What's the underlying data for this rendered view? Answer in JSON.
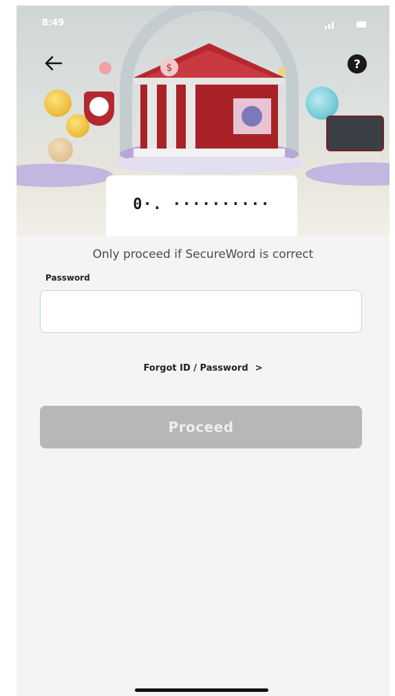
{
  "status_bar": {
    "time": "8:49"
  },
  "secure_word": {
    "value": "0·.  ··········"
  },
  "login": {
    "note": "Only proceed if SecureWord is correct",
    "password_label": "Password",
    "password_value": "",
    "forgot_label": "Forgot ID / Password",
    "forgot_chevron": ">",
    "proceed_label": "Proceed"
  },
  "icons": {
    "back": "arrow-left-icon",
    "help": "question-circle-icon"
  },
  "colors": {
    "background": "#f4f4f4",
    "button_disabled": "#b7b7b7",
    "input_border": "#b9dcd3",
    "bank_red": "#b5282f"
  }
}
